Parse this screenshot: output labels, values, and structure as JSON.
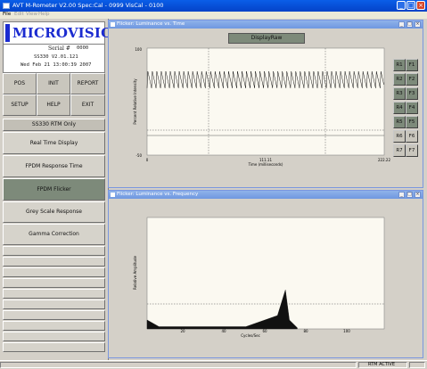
{
  "window": {
    "title": "AVT M-Rometer V2.00   Spec:Cal - 0999 VisCal - 0100"
  },
  "menu": [
    "File",
    "Edit",
    "View",
    "Help"
  ],
  "logo": {
    "text": "MICROVISION",
    "serial_label": "Serial #",
    "serial_value": "0000"
  },
  "device": {
    "model": "SS330 V2.01.121",
    "datetime": "Wed Feb 21 13:00:39 2007"
  },
  "grid_buttons": [
    "POS",
    "INIT",
    "REPORT",
    "SETUP",
    "HELP",
    "EXIT"
  ],
  "mode_label": "SS330 RTM Only",
  "nav": [
    {
      "label": "Real Time Display",
      "active": false
    },
    {
      "label": "FPDM Response Time",
      "active": false
    },
    {
      "label": "FPDM Flicker",
      "active": true
    },
    {
      "label": "Grey Scale Response",
      "active": false
    },
    {
      "label": "Gamma Correction",
      "active": false
    }
  ],
  "top_window": {
    "title": "Flicker: Luminance vs. Time",
    "display_button": "DisplayRaw",
    "ylabel": "Percent Relative Intensity",
    "xlabel": "Time (milliseconds)",
    "y_top": "100",
    "y_bottom": "-50",
    "x_left": "0",
    "x_mid": "111.11",
    "x_right": "222.22",
    "r_buttons": [
      "R1",
      "R2",
      "R3",
      "R4",
      "R5",
      "R6",
      "R7"
    ],
    "f_buttons": [
      "F1",
      "F2",
      "F3",
      "F4",
      "F5",
      "F6",
      "F7"
    ]
  },
  "bottom_window": {
    "title": "Flicker: Luminance vs. Frequency",
    "ylabel": "Relative Amplitude",
    "xlabel": "Cycles/Sec",
    "x_ticks": [
      "20",
      "40",
      "60",
      "80",
      "100"
    ]
  },
  "chart_data": [
    {
      "type": "line",
      "title": "Flicker: Luminance vs. Time",
      "xlabel": "Time (milliseconds)",
      "ylabel": "Percent Relative Intensity",
      "xlim": [
        0,
        222.22
      ],
      "ylim": [
        -50,
        100
      ],
      "grid": true,
      "period_ms": 4.2,
      "series": [
        {
          "upper": 68,
          "lower": 44
        }
      ]
    },
    {
      "type": "area",
      "title": "Flicker: Luminance vs. Frequency",
      "xlabel": "Cycles/Sec",
      "ylabel": "Relative Amplitude",
      "xlim": [
        0,
        120
      ],
      "ylim": [
        0,
        1
      ],
      "peaks": [
        {
          "x": 0,
          "y": 0.08
        },
        {
          "x": 6,
          "y": 0.02
        },
        {
          "x": 50,
          "y": 0.02
        },
        {
          "x": 66,
          "y": 0.12
        },
        {
          "x": 70,
          "y": 0.35
        },
        {
          "x": 72,
          "y": 0.08
        },
        {
          "x": 76,
          "y": 0.01
        }
      ]
    }
  ],
  "status": {
    "text": "RTM ACTIVE"
  }
}
